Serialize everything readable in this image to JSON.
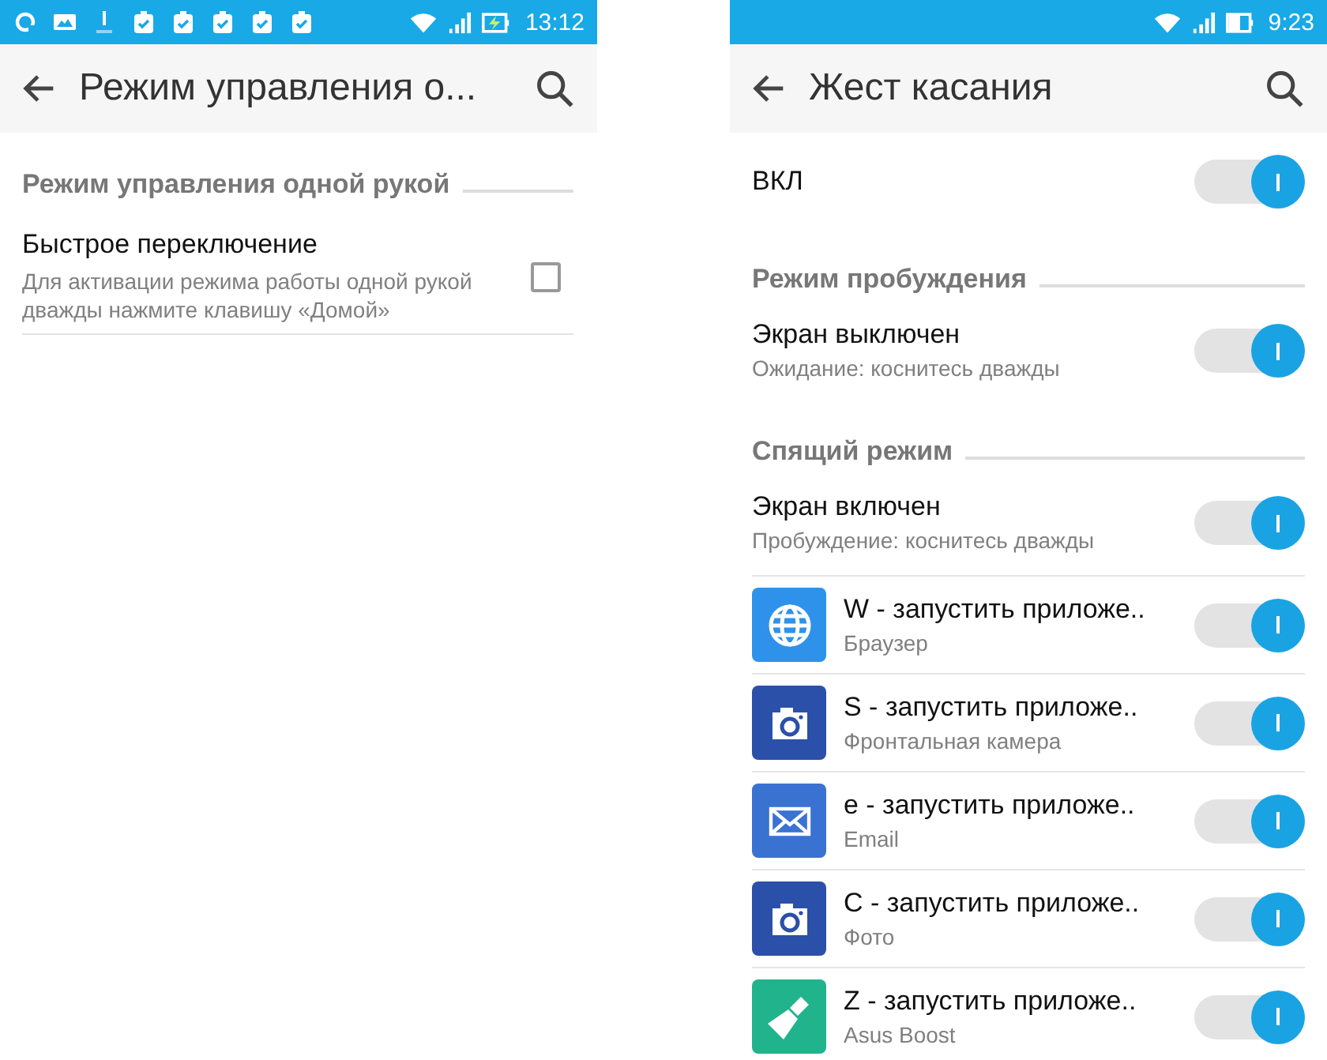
{
  "left_screen": {
    "status_bar": {
      "time": "13:12"
    },
    "app_bar": {
      "title": "Режим управления о..."
    },
    "section": {
      "header": "Режим управления одной рукой"
    },
    "setting": {
      "title": "Быстрое переключение",
      "summary": "Для активации режима работы одной рукой дважды нажмите клавишу «Домой»",
      "checked": false
    }
  },
  "right_screen": {
    "status_bar": {
      "time": "9:23"
    },
    "app_bar": {
      "title": "Жест касания"
    },
    "items": [
      {
        "kind": "toggle",
        "title": "ВКЛ",
        "on": true
      },
      {
        "kind": "header",
        "title": "Режим пробуждения"
      },
      {
        "kind": "toggle",
        "title": "Экран выключен",
        "summary": "Ожидание: коснитесь дважды",
        "on": true
      },
      {
        "kind": "header",
        "title": "Спящий режим"
      },
      {
        "kind": "toggle",
        "title": "Экран включен",
        "summary": "Пробуждение: коснитесь дважды",
        "on": true
      },
      {
        "kind": "globe_app",
        "title": "W - запустить приложе..",
        "summary": "Браузер",
        "on": true
      },
      {
        "kind": "camera_app",
        "title": "S - запустить приложе..",
        "summary": "Фронтальная камера",
        "on": true
      },
      {
        "kind": "mail_app",
        "title": "e - запустить приложе..",
        "summary": "Email",
        "on": true
      },
      {
        "kind": "camera_app",
        "title": "C - запустить приложе..",
        "summary": "Фото",
        "on": true
      },
      {
        "kind": "broom_app",
        "title": "Z - запустить приложе..",
        "summary": "Asus Boost",
        "on": true
      }
    ]
  }
}
